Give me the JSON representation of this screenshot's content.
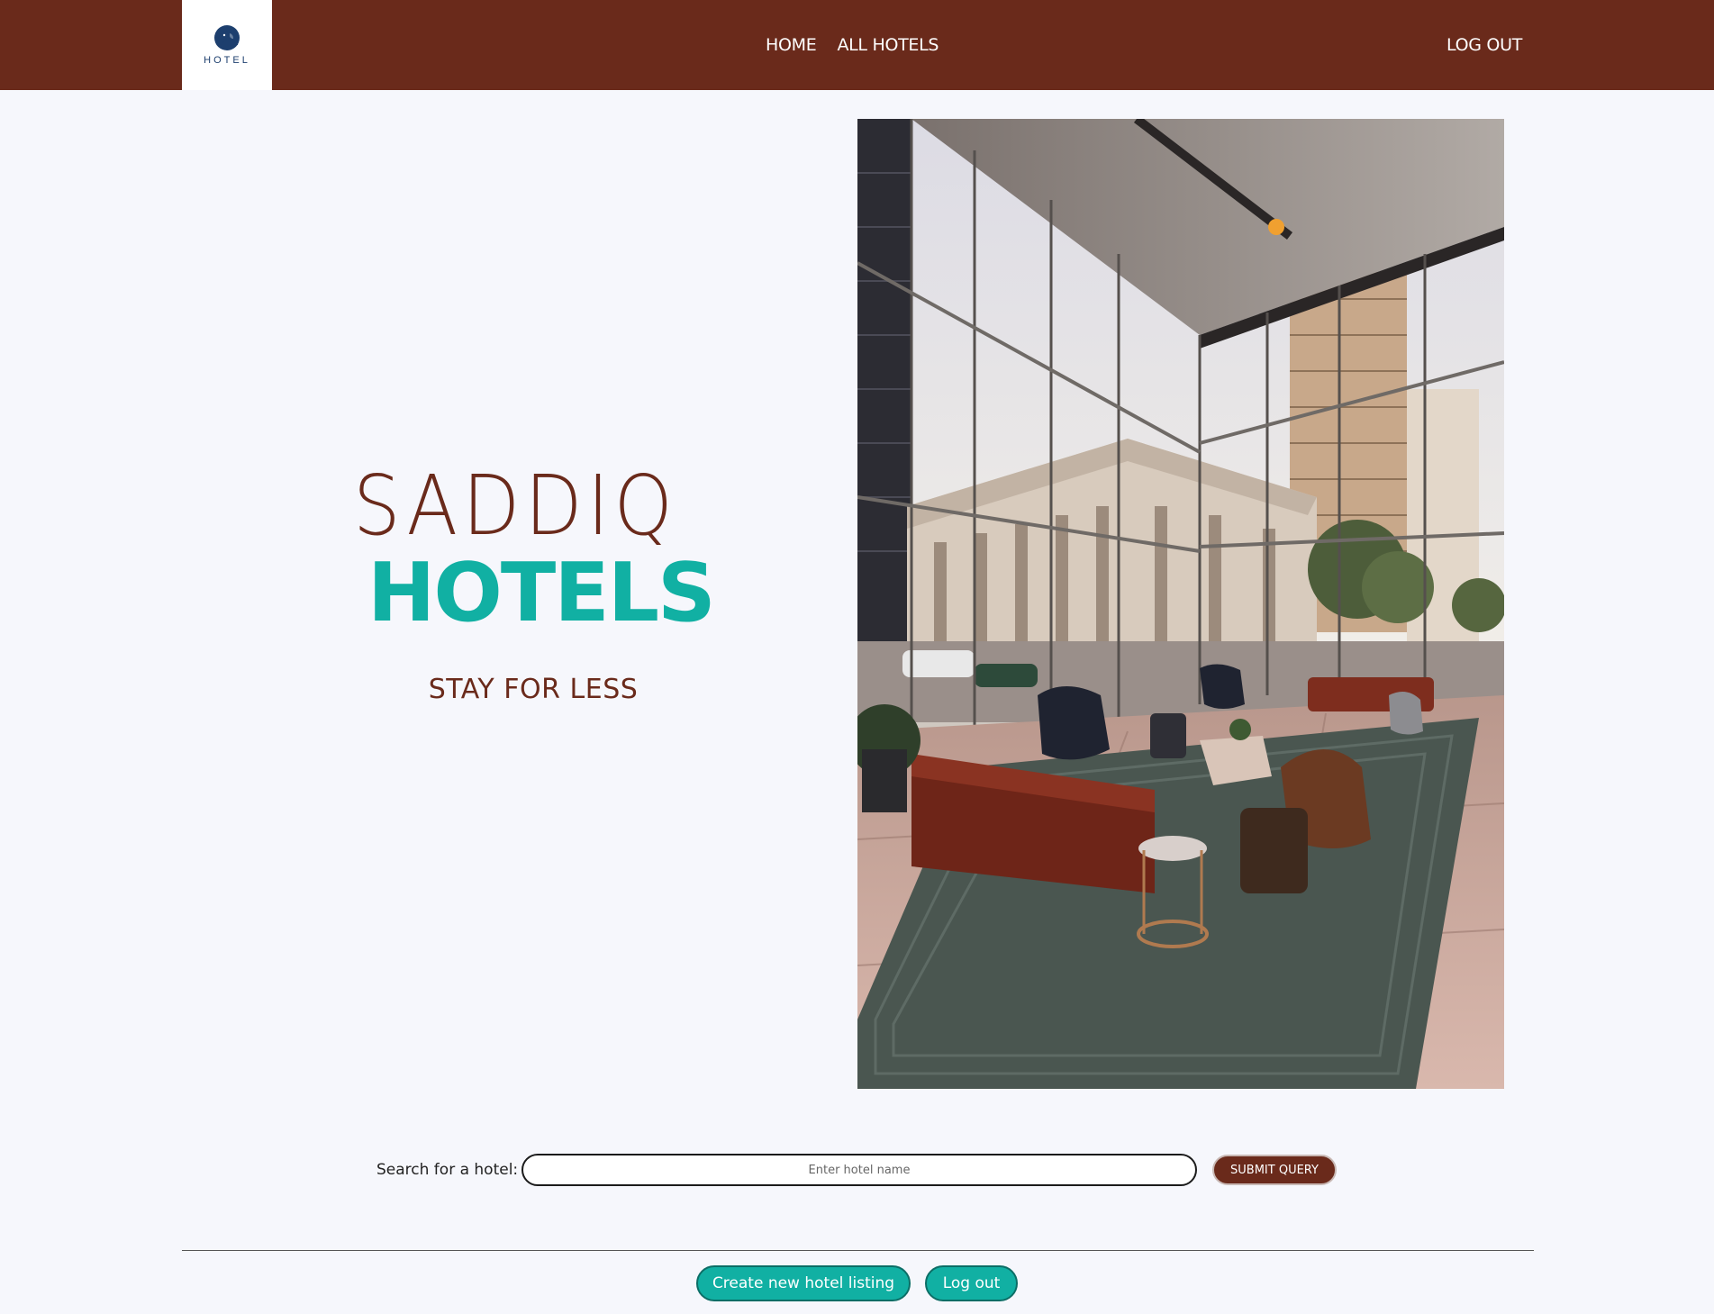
{
  "header": {
    "logo_text": "HOTEL",
    "nav": [
      {
        "label": "HOME"
      },
      {
        "label": "ALL HOTELS"
      }
    ],
    "logout_label": "LOG OUT"
  },
  "hero": {
    "title_line1": "SADDIQ",
    "title_line2": "HOTELS",
    "tagline": "STAY FOR LESS",
    "photo_icon": "hotel-lobby-photo"
  },
  "search": {
    "label": "Search for a hotel:",
    "placeholder": "Enter hotel name",
    "value": "",
    "submit_label": "SUBMIT QUERY"
  },
  "footer": {
    "create_label": "Create new hotel listing",
    "logout_label": "Log out"
  },
  "colors": {
    "brand_brown": "#6a2a1b",
    "brand_teal": "#11b0a3",
    "background": "#f6f7fc"
  }
}
